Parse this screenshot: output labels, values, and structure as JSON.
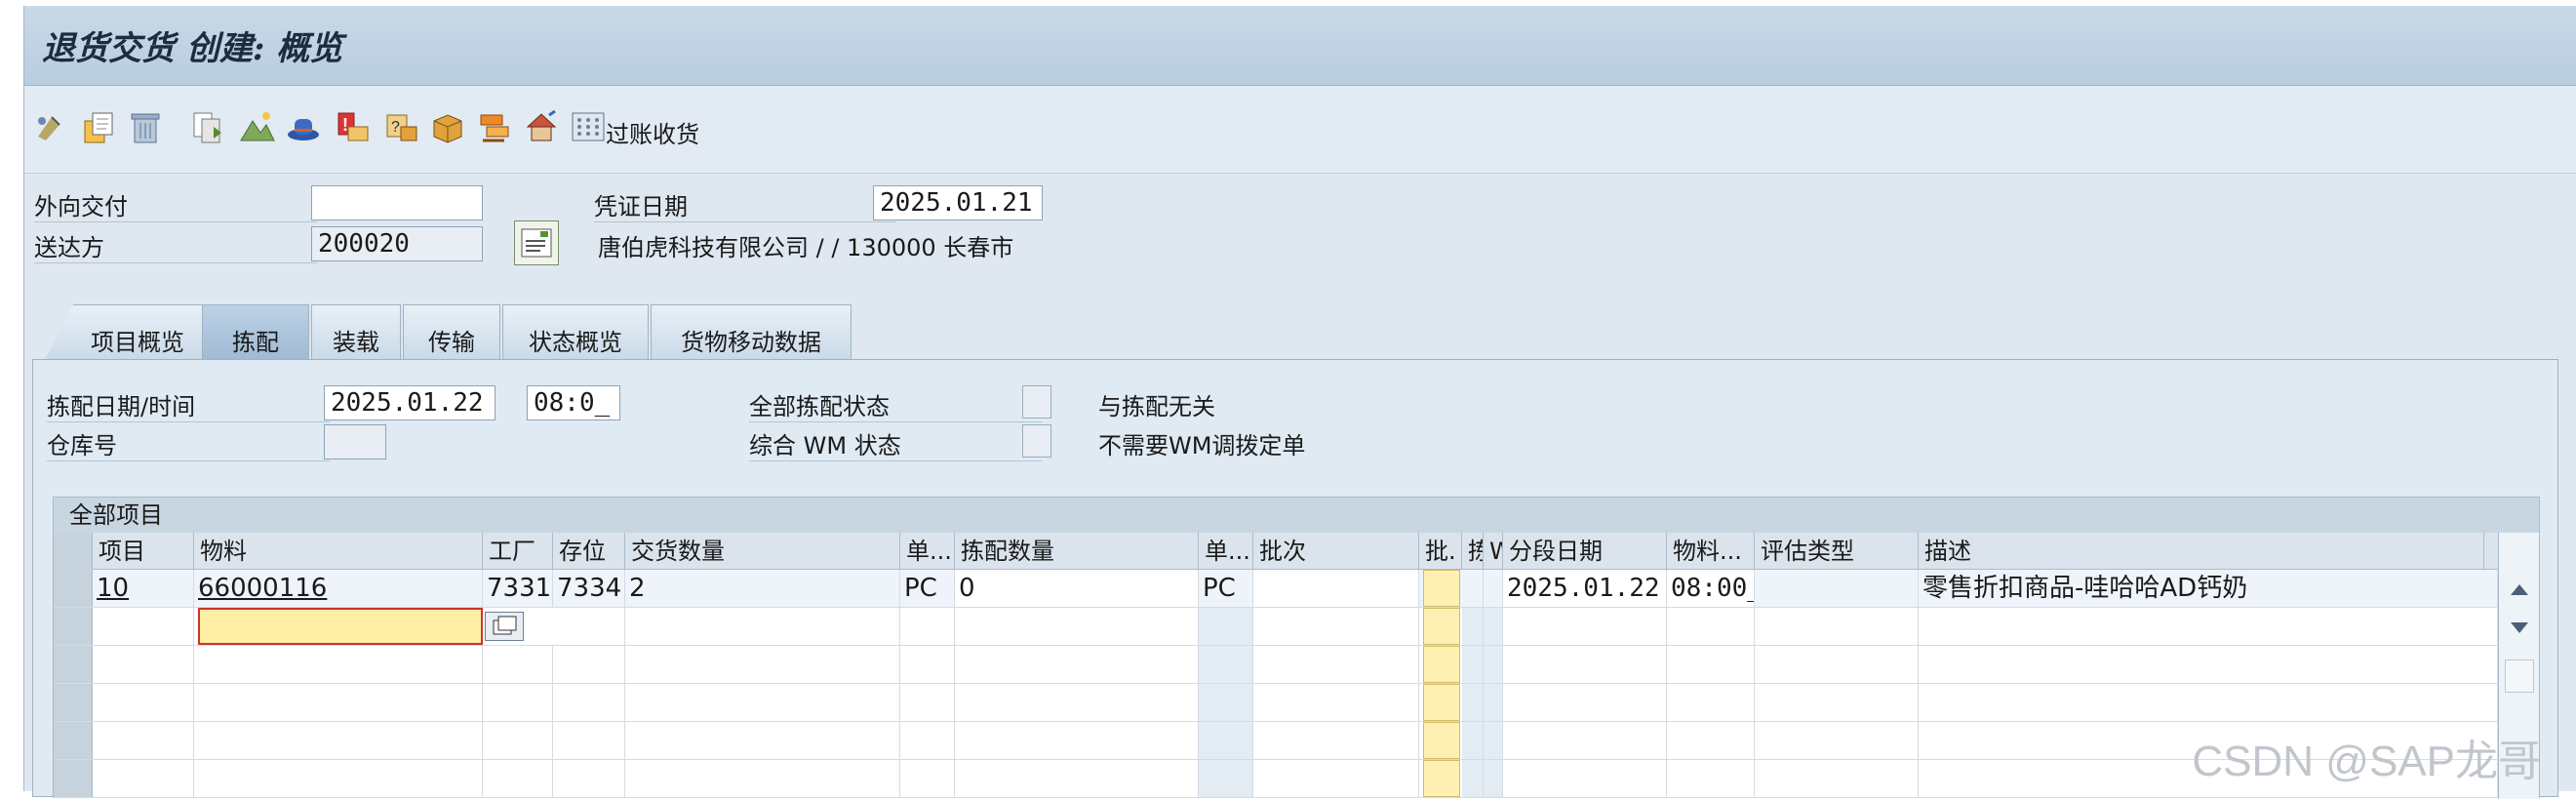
{
  "window": {
    "title": "退货交货 创建: 概览"
  },
  "toolbar": {
    "icons": [
      "display-change-icon",
      "copy-item-icon",
      "delete-trash-icon",
      "document-copy-icon",
      "mountain-image-icon",
      "hat-icon",
      "alert-warning-icon",
      "label-icon",
      "box-icon",
      "tools-icon",
      "house-icon",
      "grid-dots-icon"
    ],
    "post_goods_receipt_label": "过账收货"
  },
  "header": {
    "outbound_delivery_label": "外向交付",
    "outbound_delivery_value": "",
    "document_date_label": "凭证日期",
    "document_date_value": "2025.01.21",
    "ship_to_label": "送达方",
    "ship_to_value": "200020",
    "ship_to_desc": "唐伯虎科技有限公司 / / 130000 长春市"
  },
  "tabs": [
    {
      "label": "项目概览"
    },
    {
      "label": "拣配"
    },
    {
      "label": "装载"
    },
    {
      "label": "传输"
    },
    {
      "label": "状态概览"
    },
    {
      "label": "货物移动数据"
    }
  ],
  "picking": {
    "date_time_label": "拣配日期/时间",
    "date_value": "2025.01.22",
    "time_value": "08:0_",
    "warehouse_label": "仓库号",
    "warehouse_value": "",
    "overall_pick_status_label": "全部拣配状态",
    "overall_pick_status_text": "与拣配无关",
    "overall_wm_status_label": "综合 WM 状态",
    "overall_wm_status_text": "不需要WM调拨定单"
  },
  "grid": {
    "title": "全部项目",
    "columns": [
      "项目",
      "物料",
      "工厂",
      "存位",
      "交货数量",
      "单...",
      "拣配数量",
      "单...",
      "批次",
      "批.",
      "拣",
      "W",
      "分段日期",
      "物料...",
      "评估类型",
      "描述"
    ],
    "rows": [
      {
        "item": "10",
        "material": "66000116",
        "plant": "7331",
        "sloc": "7334",
        "deliv_qty": "2",
        "unit1": "PC",
        "pick_qty": "0",
        "unit2": "PC",
        "batch": "",
        "batch_flag": "",
        "pick_flag": "",
        "w": "",
        "date": "2025.01.22",
        "mat_time": "08:00_",
        "val_type": "",
        "desc": "零售折扣商品-哇哈哈AD钙奶"
      }
    ]
  },
  "watermark": "CSDN @SAP龙哥"
}
